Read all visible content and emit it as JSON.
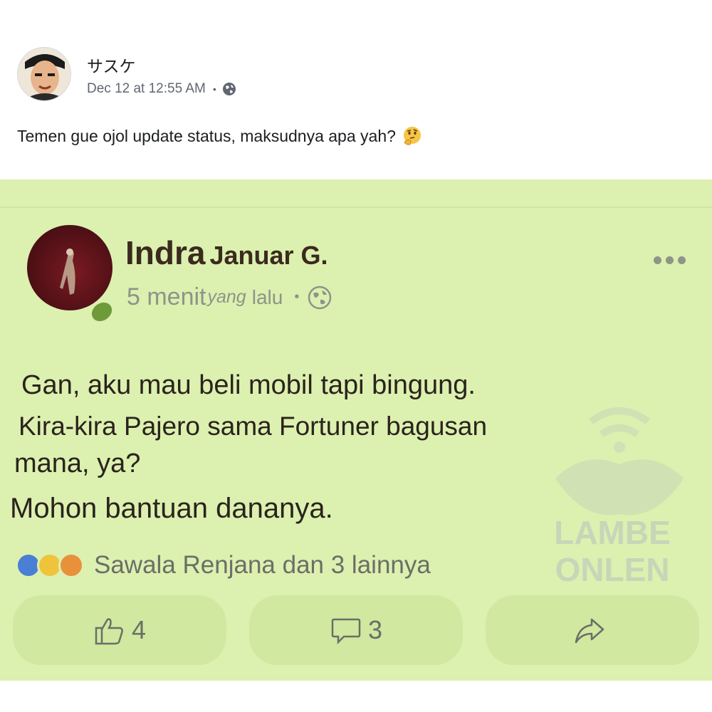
{
  "post": {
    "author_name": "サスケ",
    "timestamp": "Dec 12 at 12:55 AM",
    "caption": "Temen gue ojol update status, maksudnya apa yah?"
  },
  "shared": {
    "name_first": "Indra",
    "name_last": "Januar G.",
    "time_a": "5 menit",
    "time_b": "yang",
    "time_c": "lalu",
    "lines": [
      "Gan, aku mau beli mobil tapi bingung.",
      "Kira-kira Pajero sama Fortuner bagusan",
      "mana, ya?",
      "Mohon bantuan dananya."
    ],
    "reactions_text": "Sawala Renjana dan 3 lainnya",
    "like_count": "4",
    "comment_count": "3"
  },
  "watermark": {
    "text": "LAMBE\nONLEN"
  },
  "icons": [
    "globe-icon",
    "thinking-face-icon",
    "more-icon",
    "like-reaction-icon",
    "haha-reaction-icon",
    "angry-reaction-icon",
    "thumbs-up-icon",
    "comment-icon",
    "share-icon"
  ],
  "colors": {
    "card_green": "#dcf0b0",
    "button_green": "#d0e8a0",
    "text_dark": "#2a231c"
  }
}
